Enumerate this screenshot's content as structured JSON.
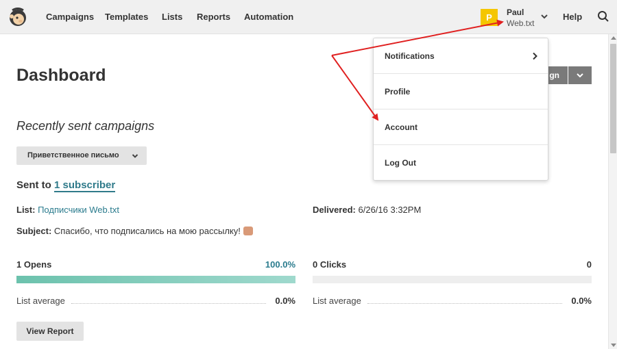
{
  "nav": {
    "items": [
      {
        "label": "Campaigns"
      },
      {
        "label": "Templates"
      },
      {
        "label": "Lists"
      },
      {
        "label": "Reports"
      },
      {
        "label": "Automation"
      }
    ],
    "user": {
      "initial": "P",
      "name": "Paul",
      "org": "Web.txt"
    },
    "help_label": "Help"
  },
  "page": {
    "title": "Dashboard",
    "create_button_label": "gn"
  },
  "recent": {
    "section_title": "Recently sent campaigns",
    "campaign_select": "Приветственное письмо",
    "sent_to_prefix": "Sent to",
    "sent_to_link": "1 subscriber",
    "list_label": "List:",
    "list_value": "Подписчики Web.txt",
    "delivered_label": "Delivered:",
    "delivered_value": "6/26/16 3:32PM",
    "subject_label": "Subject:",
    "subject_value": "Спасибо, что подписались на мою рассылку!"
  },
  "stats": {
    "opens_label": "1 Opens",
    "opens_value": "100.0%",
    "opens_fraction": 1.0,
    "clicks_label": "0 Clicks",
    "clicks_value": "0",
    "clicks_fraction": 0.0,
    "opens_avg_label": "List average",
    "opens_avg_value": "0.0%",
    "clicks_avg_label": "List average",
    "clicks_avg_value": "0.0%"
  },
  "view_report_label": "View Report",
  "dropdown": {
    "items": [
      {
        "label": "Notifications"
      },
      {
        "label": "Profile"
      },
      {
        "label": "Account"
      },
      {
        "label": "Log Out"
      }
    ]
  },
  "colors": {
    "accent_link": "#2a7b8d",
    "avatar": "#f5c600",
    "progress": "#6cc2ad",
    "annotation_arrow": "#e02020"
  }
}
